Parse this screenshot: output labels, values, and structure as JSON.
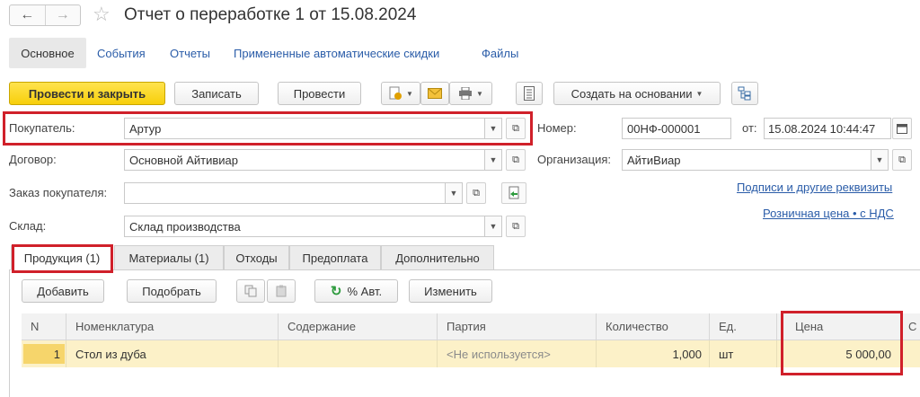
{
  "header": {
    "back_icon": "←",
    "forward_icon": "→",
    "star_icon": "☆",
    "title": "Отчет о переработке 1 от 15.08.2024"
  },
  "form_tabs": {
    "main": "Основное",
    "events": "События",
    "reports": "Отчеты",
    "discounts": "Примененные автоматические скидки",
    "files": "Файлы"
  },
  "toolbar": {
    "post_close": "Провести и закрыть",
    "save": "Записать",
    "post": "Провести",
    "create_based_on": "Создать на основании"
  },
  "fields": {
    "buyer_label": "Покупатель:",
    "buyer_value": "Артур",
    "contract_label": "Договор:",
    "contract_value": "Основной Айтивиар",
    "order_label": "Заказ покупателя:",
    "order_value": "",
    "warehouse_label": "Склад:",
    "warehouse_value": "Склад производства",
    "number_label": "Номер:",
    "number_value": "00НФ-000001",
    "date_label": "от:",
    "date_value": "15.08.2024 10:44:47",
    "org_label": "Организация:",
    "org_value": "АйтиВиар",
    "signatures_link": "Подписи и другие реквизиты",
    "price_link": "Розничная цена • с НДС"
  },
  "inner_tabs": {
    "products": "Продукция (1)",
    "materials": "Материалы (1)",
    "waste": "Отходы",
    "prepayment": "Предоплата",
    "additional": "Дополнительно"
  },
  "table_toolbar": {
    "add": "Добавить",
    "select": "Подобрать",
    "auto_percent": "% Авт.",
    "change": "Изменить"
  },
  "table": {
    "columns": {
      "n": "N",
      "item": "Номенклатура",
      "content": "Содержание",
      "batch": "Партия",
      "qty": "Количество",
      "unit": "Ед.",
      "price": "Цена",
      "sum_partial": "С"
    },
    "row1": {
      "n": "1",
      "item": "Стол из дуба",
      "content": "",
      "batch": "<Не используется>",
      "qty": "1,000",
      "unit": "шт",
      "price": "5 000,00"
    }
  },
  "colors": {
    "primary_button": "#f7cf0b",
    "highlight_border": "#d0202a",
    "link": "#2a5ca8",
    "row_selected": "#fcf1c8"
  }
}
